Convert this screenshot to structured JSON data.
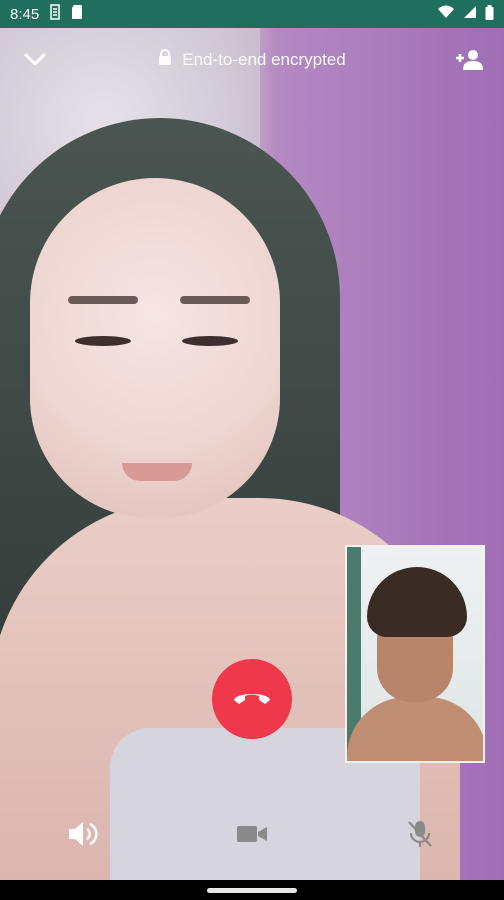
{
  "status_bar": {
    "time": "8:45",
    "icons": [
      "sim-s-icon",
      "sd-card-icon",
      "wifi-icon",
      "signal-icon",
      "battery-icon"
    ]
  },
  "top_bar": {
    "minimize_icon": "chevron-down-icon",
    "encrypted_icon": "lock-icon",
    "encrypted_text": "End-to-end encrypted",
    "add_participant_icon": "add-person-icon"
  },
  "call_controls": {
    "end_call_icon": "phone-hangup-icon",
    "speaker_icon": "speaker-icon",
    "camera_icon": "video-camera-icon",
    "mute_icon": "mic-off-icon"
  },
  "colors": {
    "status_bar": "#1f6f5c",
    "end_call": "#f0384c",
    "icon": "#ffffff",
    "disabled_icon": "#9a9a9a"
  }
}
